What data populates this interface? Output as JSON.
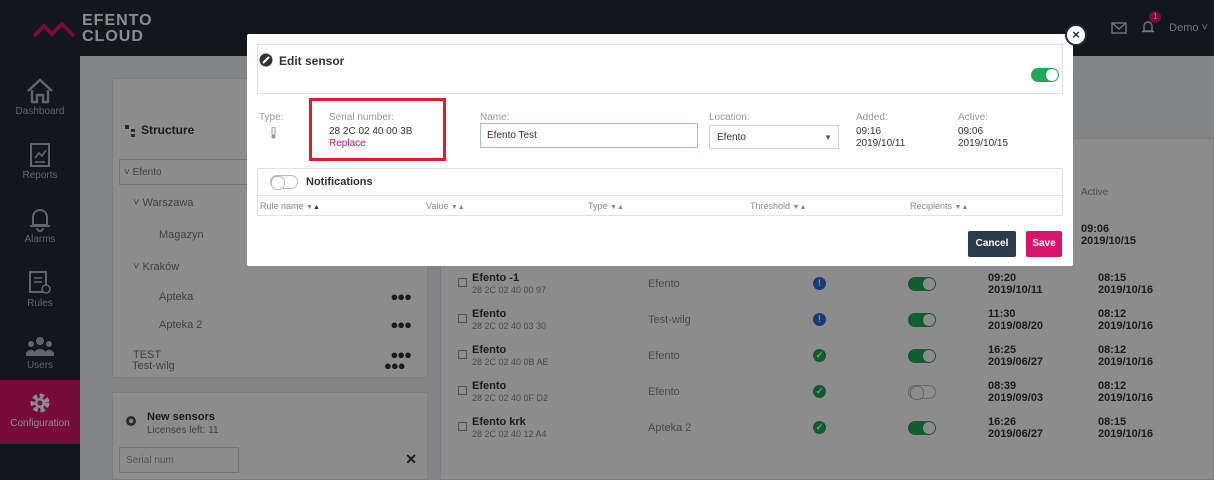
{
  "app": {
    "logo_line1": "EFENTO",
    "logo_line2": "CLOUD",
    "notification_count": "1",
    "user_label": "Demo ˅",
    "accent": "#d9146b",
    "sidebar_bg": "#1f2a36"
  },
  "sidebar": {
    "items": [
      {
        "label": "Dashboard",
        "icon": "home-icon"
      },
      {
        "label": "Reports",
        "icon": "report-icon"
      },
      {
        "label": "Alarms",
        "icon": "bell-icon"
      },
      {
        "label": "Rules",
        "icon": "rules-icon"
      },
      {
        "label": "Users",
        "icon": "users-icon"
      },
      {
        "label": "Configuration",
        "icon": "gear-icon"
      }
    ]
  },
  "structure": {
    "title": "Structure",
    "selected": "˅ Efento",
    "tree": [
      {
        "label": "˅ Warszawa",
        "indent": 1
      },
      {
        "label": "Magazyn",
        "indent": 2
      },
      {
        "label": "˅ Kraków",
        "indent": 1
      },
      {
        "label": "Apteka",
        "indent": 2
      },
      {
        "label": "Apteka 2",
        "indent": 2
      },
      {
        "label": "TEST",
        "indent": 1
      },
      {
        "label": "Test-wilg",
        "indent": 1
      }
    ]
  },
  "new_sensors": {
    "title": "New sensors",
    "licenses": "Licenses left: 11",
    "serial_filter_placeholder": "Serial num"
  },
  "sensors_table": {
    "active_header": "Active",
    "top_active": {
      "time": "09:06",
      "date": "2019/10/15"
    },
    "rows": [
      {
        "name": "Efento -1",
        "serial": "28 2C 02 40 00 97",
        "location": "Efento",
        "status": "info",
        "enabled": true,
        "added_time": "09:20",
        "added_date": "2019/10/11",
        "active_time": "08:15",
        "active_date": "2019/10/16"
      },
      {
        "name": "Efento",
        "serial": "28 2C 02 40 03 30",
        "location": "Test-wilg",
        "status": "info",
        "enabled": true,
        "added_time": "11:30",
        "added_date": "2019/08/20",
        "active_time": "08:12",
        "active_date": "2019/10/16"
      },
      {
        "name": "Efento",
        "serial": "28 2C 02 40 0B AE",
        "location": "Efento",
        "status": "ok",
        "enabled": true,
        "added_time": "16:25",
        "added_date": "2019/06/27",
        "active_time": "08:12",
        "active_date": "2019/10/16"
      },
      {
        "name": "Efento",
        "serial": "28 2C 02 40 0F D2",
        "location": "Efento",
        "status": "ok",
        "enabled": false,
        "added_time": "08:39",
        "added_date": "2019/09/03",
        "active_time": "08:12",
        "active_date": "2019/10/16"
      },
      {
        "name": "Efento krk",
        "serial": "28 2C 02 40 12 A4",
        "location": "Apteka 2",
        "status": "ok",
        "enabled": true,
        "added_time": "16:26",
        "added_date": "2019/06/27",
        "active_time": "08:15",
        "active_date": "2019/10/16"
      }
    ]
  },
  "modal": {
    "title": "Edit sensor",
    "enabled": true,
    "type_label": "Type:",
    "serial_label": "Serial number:",
    "serial_value": "28 2C 02 40 00 3B",
    "replace_label": "Replace",
    "name_label": "Name:",
    "name_value": "Efento Test",
    "location_label": "Location:",
    "location_value": "Efento",
    "added_label": "Added:",
    "added_time": "09:16",
    "added_date": "2019/10/11",
    "active_label": "Active:",
    "active_time": "09:06",
    "active_date": "2019/10/15",
    "notifications_title": "Notifications",
    "notifications_enabled": false,
    "columns": [
      "Rule name",
      "Value",
      "Type",
      "Threshold",
      "Recipients"
    ],
    "cancel_label": "Cancel",
    "save_label": "Save",
    "close_label": "×"
  }
}
